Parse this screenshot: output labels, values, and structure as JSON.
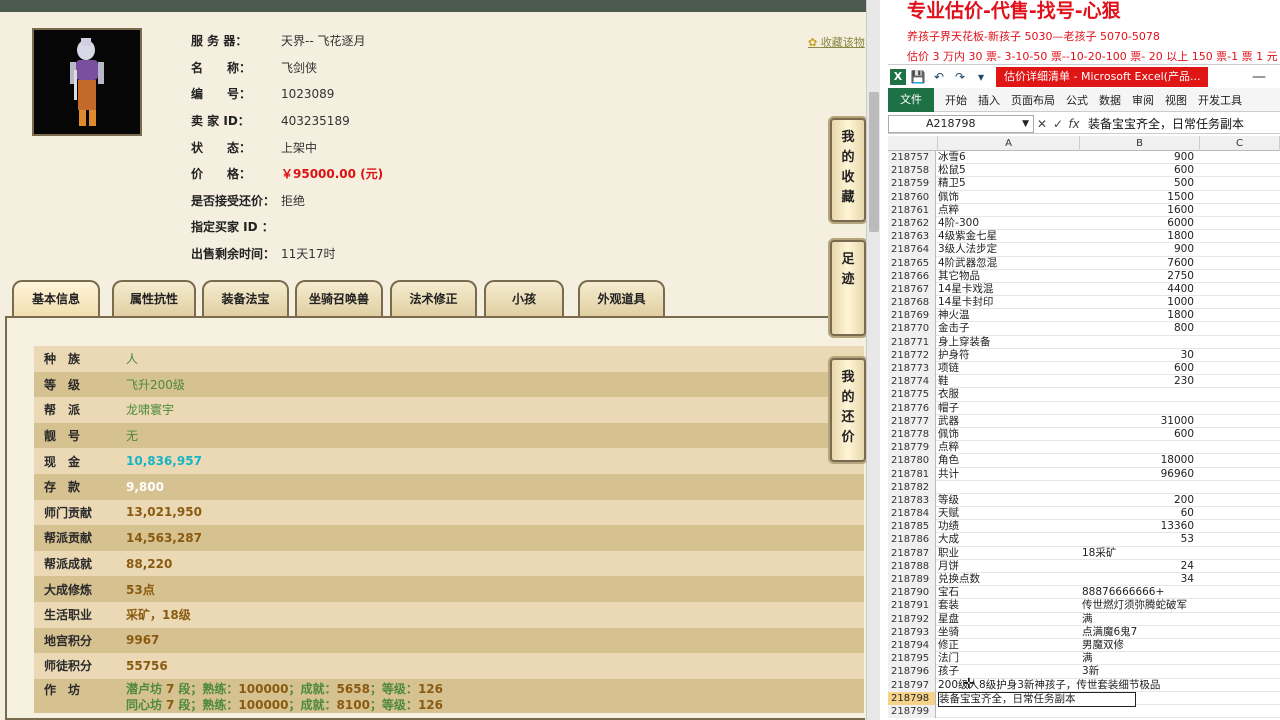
{
  "header": {
    "favorite_link": "收藏该物",
    "fields": [
      {
        "label": "服 务 器：",
        "value": "天界-- 飞花逐月"
      },
      {
        "label": "名　　称：",
        "value": "飞剑侠"
      },
      {
        "label": "编　　号：",
        "value": "1023089"
      },
      {
        "label": "卖 家  ID：",
        "value": "403235189"
      },
      {
        "label": "状　　态：",
        "value": "上架中"
      },
      {
        "label": "价　　格：",
        "value": "￥95000.00 (元)"
      },
      {
        "label": "是否接受还价：",
        "value": "拒绝"
      },
      {
        "label": "指定买家 ID ：",
        "value": ""
      },
      {
        "label": "出售剩余时间：",
        "value": "11天17时"
      }
    ]
  },
  "tabs": [
    "基本信息",
    "属性抗性",
    "装备法宝",
    "坐骑召唤兽",
    "法术修正",
    "小孩",
    "外观道具"
  ],
  "side_buttons": [
    "我的收藏",
    "足迹",
    "我的还价"
  ],
  "stats": [
    {
      "k": "种　族",
      "v": "人"
    },
    {
      "k": "等　级",
      "v": "飞升200级"
    },
    {
      "k": "帮　派",
      "v": "龙啸寰宇"
    },
    {
      "k": "靓　号",
      "v": "无"
    },
    {
      "k": "现　金",
      "v": "10,836,957"
    },
    {
      "k": "存　款",
      "v": "9,800"
    },
    {
      "k": "师门贡献",
      "v": "13,021,950"
    },
    {
      "k": "帮派贡献",
      "v": "14,563,287"
    },
    {
      "k": "帮派成就",
      "v": "88,220"
    },
    {
      "k": "大成修炼",
      "v": "53点"
    },
    {
      "k": "生活职业",
      "v": "采矿，18级"
    },
    {
      "k": "地宫积分",
      "v": "9967"
    },
    {
      "k": "师徒积分",
      "v": "55756"
    }
  ],
  "workshop": {
    "k": "作　坊",
    "lines": [
      {
        "name": "潜卢坊",
        "level": "7",
        "unit": "段；熟练：",
        "skill": "100000",
        "ach_label": "；成就：",
        "ach": "5658",
        "grade_label": "；等级：",
        "grade": "126"
      },
      {
        "name": "同心坊",
        "level": "7",
        "unit": "段；熟练：",
        "skill": "100000",
        "ach_label": "；成就：",
        "ach": "8100",
        "grade_label": "；等级：",
        "grade": "126"
      }
    ]
  },
  "banner": {
    "title": "专业估价-代售-找号-心狠",
    "line2": "养孩子界天花板-新孩子 5030—老孩子 5070-5078",
    "line3": "估价 3 万内 30 票- 3-10-50 票--10-20-100 票- 20 以上 150 票-1 票 1 元"
  },
  "excel": {
    "doc_title": "估价详细清单 - Microsoft Excel(产品...",
    "ribbon_file": "文件",
    "ribbon_tabs": [
      "开始",
      "插入",
      "页面布局",
      "公式",
      "数据",
      "审阅",
      "视图",
      "开发工具"
    ],
    "namebox": "A218798",
    "formula": "装备宝宝齐全，日常任务副本",
    "columns": [
      "A",
      "B",
      "C"
    ],
    "rows": [
      {
        "n": "218757",
        "a": "冰雪6",
        "b": "900"
      },
      {
        "n": "218758",
        "a": "松鼠5",
        "b": "600"
      },
      {
        "n": "218759",
        "a": "精卫5",
        "b": "500"
      },
      {
        "n": "218760",
        "a": "佩饰",
        "b": "1500"
      },
      {
        "n": "218761",
        "a": "点粹",
        "b": "1600"
      },
      {
        "n": "218762",
        "a": "4阶-300",
        "b": "6000"
      },
      {
        "n": "218763",
        "a": "4级紫金七星",
        "b": "1800"
      },
      {
        "n": "218764",
        "a": "3级人法步定",
        "b": "900"
      },
      {
        "n": "218765",
        "a": "4阶武器忽混",
        "b": "7600"
      },
      {
        "n": "218766",
        "a": "其它物品",
        "b": "2750"
      },
      {
        "n": "218767",
        "a": "14星卡戏混",
        "b": "4400"
      },
      {
        "n": "218768",
        "a": "14星卡封印",
        "b": "1000"
      },
      {
        "n": "218769",
        "a": "神火温",
        "b": "1800"
      },
      {
        "n": "218770",
        "a": "金击子",
        "b": "800"
      },
      {
        "n": "218771",
        "a": "身上穿装备",
        "b": ""
      },
      {
        "n": "218772",
        "a": "护身符",
        "b": "30"
      },
      {
        "n": "218773",
        "a": "项链",
        "b": "600"
      },
      {
        "n": "218774",
        "a": "鞋",
        "b": "230"
      },
      {
        "n": "218775",
        "a": "衣服",
        "b": ""
      },
      {
        "n": "218776",
        "a": "帽子",
        "b": ""
      },
      {
        "n": "218777",
        "a": "武器",
        "b": "31000"
      },
      {
        "n": "218778",
        "a": "佩饰",
        "b": "600"
      },
      {
        "n": "218779",
        "a": "点粹",
        "b": ""
      },
      {
        "n": "218780",
        "a": "角色",
        "b": "18000"
      },
      {
        "n": "218781",
        "a": "共计",
        "b": "96960"
      },
      {
        "n": "218782",
        "a": "",
        "b": ""
      },
      {
        "n": "218783",
        "a": "等级",
        "b": "200"
      },
      {
        "n": "218784",
        "a": "天赋",
        "b": "60"
      },
      {
        "n": "218785",
        "a": "功绩",
        "b": "13360"
      },
      {
        "n": "218786",
        "a": "大成",
        "b": "53"
      },
      {
        "n": "218787",
        "a": "职业",
        "b": "18采矿",
        "left": true
      },
      {
        "n": "218788",
        "a": "月饼",
        "b": "24"
      },
      {
        "n": "218789",
        "a": "兑换点数",
        "b": "34"
      },
      {
        "n": "218790",
        "a": "宝石",
        "b": "88876666666+",
        "left": true
      },
      {
        "n": "218791",
        "a": "套装",
        "b": "传世燃灯须弥腾蛇破军",
        "left": true
      },
      {
        "n": "218792",
        "a": "星盘",
        "b": "满",
        "left": true
      },
      {
        "n": "218793",
        "a": "坐骑",
        "b": "点满魔6鬼7",
        "left": true
      },
      {
        "n": "218794",
        "a": "修正",
        "b": "男魔双修",
        "left": true
      },
      {
        "n": "218795",
        "a": "法门",
        "b": "满",
        "left": true
      },
      {
        "n": "218796",
        "a": "孩子",
        "b": "3新",
        "left": true
      },
      {
        "n": "218797",
        "a": "200级人8级护身3新神孩子，传世套装细节极品",
        "b": ""
      },
      {
        "n": "218798",
        "a": "装备宝宝齐全，日常任务副本",
        "b": "",
        "sel": true
      },
      {
        "n": "218799",
        "a": "",
        "b": ""
      }
    ]
  }
}
